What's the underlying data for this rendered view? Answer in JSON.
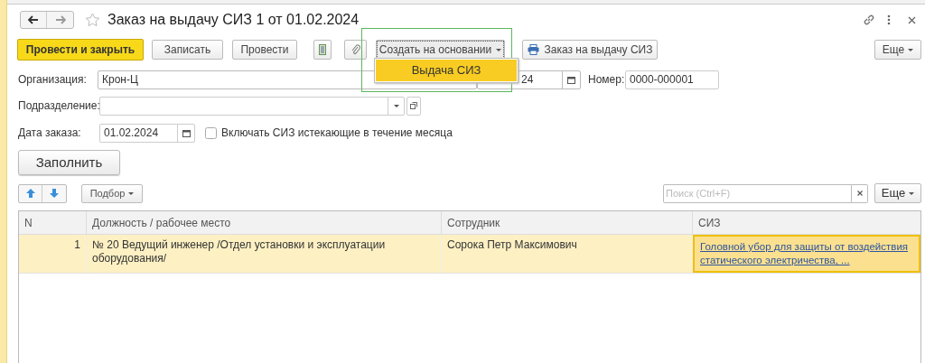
{
  "window": {
    "title": "Заказ на выдачу СИЗ 1 от 01.02.2024",
    "favorite": false
  },
  "toolbar": {
    "buttons": [
      {
        "label": "Провести и закрыть",
        "kind": "primary"
      },
      {
        "label": "Записать",
        "kind": "plain"
      },
      {
        "label": "Провести",
        "kind": "plain"
      },
      {
        "kind": "list"
      },
      {
        "kind": "clip"
      },
      {
        "label": "Создать на основании",
        "kind": "dropdown",
        "expanded": true
      },
      {
        "label": "Заказ на выдачу СИЗ",
        "kind": "print"
      }
    ],
    "more": "Еще"
  },
  "dropdown_menu": {
    "items": [
      {
        "label": "Выдача СИЗ",
        "selected": true
      }
    ]
  },
  "fields": {
    "organization": {
      "label": "Организация:",
      "value": "Крон-Ц"
    },
    "date": {
      "value": "24"
    },
    "number": {
      "label": "Номер:",
      "value": "0000-000001"
    },
    "department": {
      "label": "Подразделение:"
    },
    "order_date": {
      "label": "Дата заказа:",
      "value": "01.02.2024"
    },
    "include_expiring": {
      "label": "Включать СИЗ истекающие в течение месяца",
      "checked": false
    }
  },
  "fill_button": "Заполнить",
  "table_toolbar": {
    "selection": "Подбор",
    "search": {
      "placeholder": "Поиск (Ctrl+F)"
    },
    "more": "Еще"
  },
  "table": {
    "columns": [
      "N",
      "Должность / рабочее место",
      "Сотрудник",
      "СИЗ"
    ],
    "rows": [
      {
        "selected": true,
        "cells": [
          {
            "text": "1",
            "kind": "number",
            "focused": false
          },
          {
            "text": "№ 20 Ведущий инженер /Отдел установки и эксплуатации оборудования/",
            "kind": "text",
            "focused": false
          },
          {
            "text": "Сорока Петр Максимович",
            "kind": "text",
            "focused": false
          },
          {
            "text": "Головной убор для защиты от воздействия статического электричества, ...",
            "kind": "link",
            "focused": true
          }
        ]
      }
    ]
  }
}
